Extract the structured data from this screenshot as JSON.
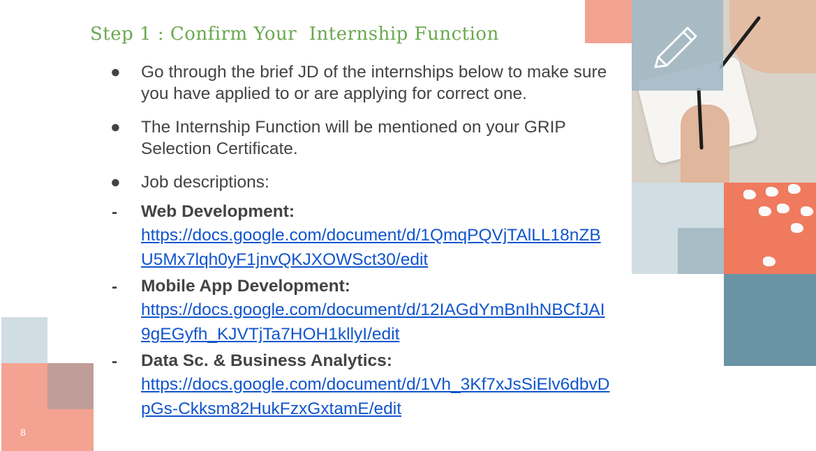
{
  "slide": {
    "title": "Step 1 : Confirm Your  Internship Function",
    "page_number": "8"
  },
  "bullets": [
    {
      "marker": "●",
      "text": "Go through the brief JD of the internships below to make sure you have applied to or are applying for correct one."
    },
    {
      "marker": "●",
      "text": "The Internship Function will be mentioned on your GRIP Selection Certificate."
    },
    {
      "marker": "●",
      "text": "Job descriptions:"
    }
  ],
  "jobs": [
    {
      "marker": "-",
      "label": "Web Development:",
      "link": "https://docs.google.com/document/d/1QmqPQVjTAlLL18nZBU5Mx7lqh0yF1jnvQKJXOWSct30/edit"
    },
    {
      "marker": "-",
      "label": "Mobile App Development:",
      "link": "https://docs.google.com/document/d/12IAGdYmBnIhNBCfJAI9gEGyfh_KJVTjTa7HOH1kllyI/edit"
    },
    {
      "marker": "-",
      "label": "Data Sc. & Business Analytics:",
      "link": "https://docs.google.com/document/d/1Vh_3Kf7xJsSiElv6dbvDpGs-Ckksm82HukFzxGxtamE/edit"
    }
  ],
  "colors": {
    "title_green": "#6aa84f",
    "link_blue": "#1155cc",
    "body_text": "#434343",
    "salmon": "#f4a291",
    "light_blue_grey": "#d0dde3",
    "mid_blue_grey": "#a8bcc6",
    "steel_blue": "#6b93a6",
    "mauve": "#c09d98",
    "coral": "#f07a5e"
  },
  "icons": {
    "pencil": "pencil-icon",
    "pen": "pen-icon"
  }
}
